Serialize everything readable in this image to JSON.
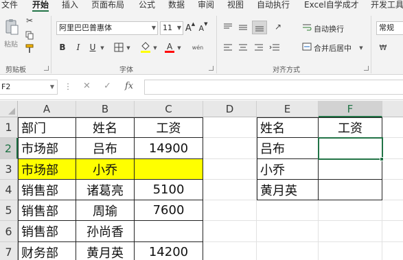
{
  "ribbon_tabs": [
    "文件",
    "开始",
    "插入",
    "页面布局",
    "公式",
    "数据",
    "审阅",
    "视图",
    "自动执行",
    "Excel自学成才",
    "开发工具"
  ],
  "ribbon": {
    "paste_label": "粘贴",
    "clipboard_group": "剪贴板",
    "font_group": "字体",
    "alignment_group": "对齐方式",
    "font_name": "阿里巴巴普惠体",
    "font_size": "11",
    "increase_font": "A",
    "decrease_font": "A",
    "bold": "B",
    "italic": "I",
    "underline": "U",
    "wen": "wén",
    "wrap_text": "自动换行",
    "merge_center": "合并后居中",
    "number_format": "常规",
    "icons": {
      "paste": "paste-icon",
      "cut": "scissors-icon",
      "copy": "copy-icon",
      "format_painter": "brush-icon",
      "borders": "border-icon",
      "fill_color": "fill-bucket-icon",
      "font_color": "font-color-icon",
      "wrap": "wrap-text-icon",
      "merge": "merge-icon"
    },
    "colors": {
      "fill": "#ffff00",
      "font": "#ff0000",
      "accent": "#217346"
    }
  },
  "formula_bar": {
    "name_box": "F2",
    "cancel": "✕",
    "enter": "✓",
    "fx": "fx",
    "content": ""
  },
  "sheet": {
    "columns": [
      "A",
      "B",
      "C",
      "D",
      "E",
      "F"
    ],
    "rows": [
      "1",
      "2",
      "3",
      "4",
      "5",
      "6",
      "7"
    ],
    "selected_cell": "F2",
    "source_table": {
      "header": [
        "部门",
        "姓名",
        "工资"
      ],
      "rows": [
        [
          "市场部",
          "吕布",
          "14900"
        ],
        [
          "市场部",
          "小乔",
          ""
        ],
        [
          "销售部",
          "诸葛亮",
          "5100"
        ],
        [
          "销售部",
          "周瑜",
          "7600"
        ],
        [
          "销售部",
          "孙尚香",
          ""
        ],
        [
          "财务部",
          "黄月英",
          "14200"
        ]
      ],
      "highlight_row": 2,
      "highlight_color": "#ffff00"
    },
    "lookup_table": {
      "header": [
        "姓名",
        "工资"
      ],
      "rows": [
        [
          "吕布",
          ""
        ],
        [
          "小乔",
          ""
        ],
        [
          "黄月英",
          ""
        ]
      ]
    }
  }
}
